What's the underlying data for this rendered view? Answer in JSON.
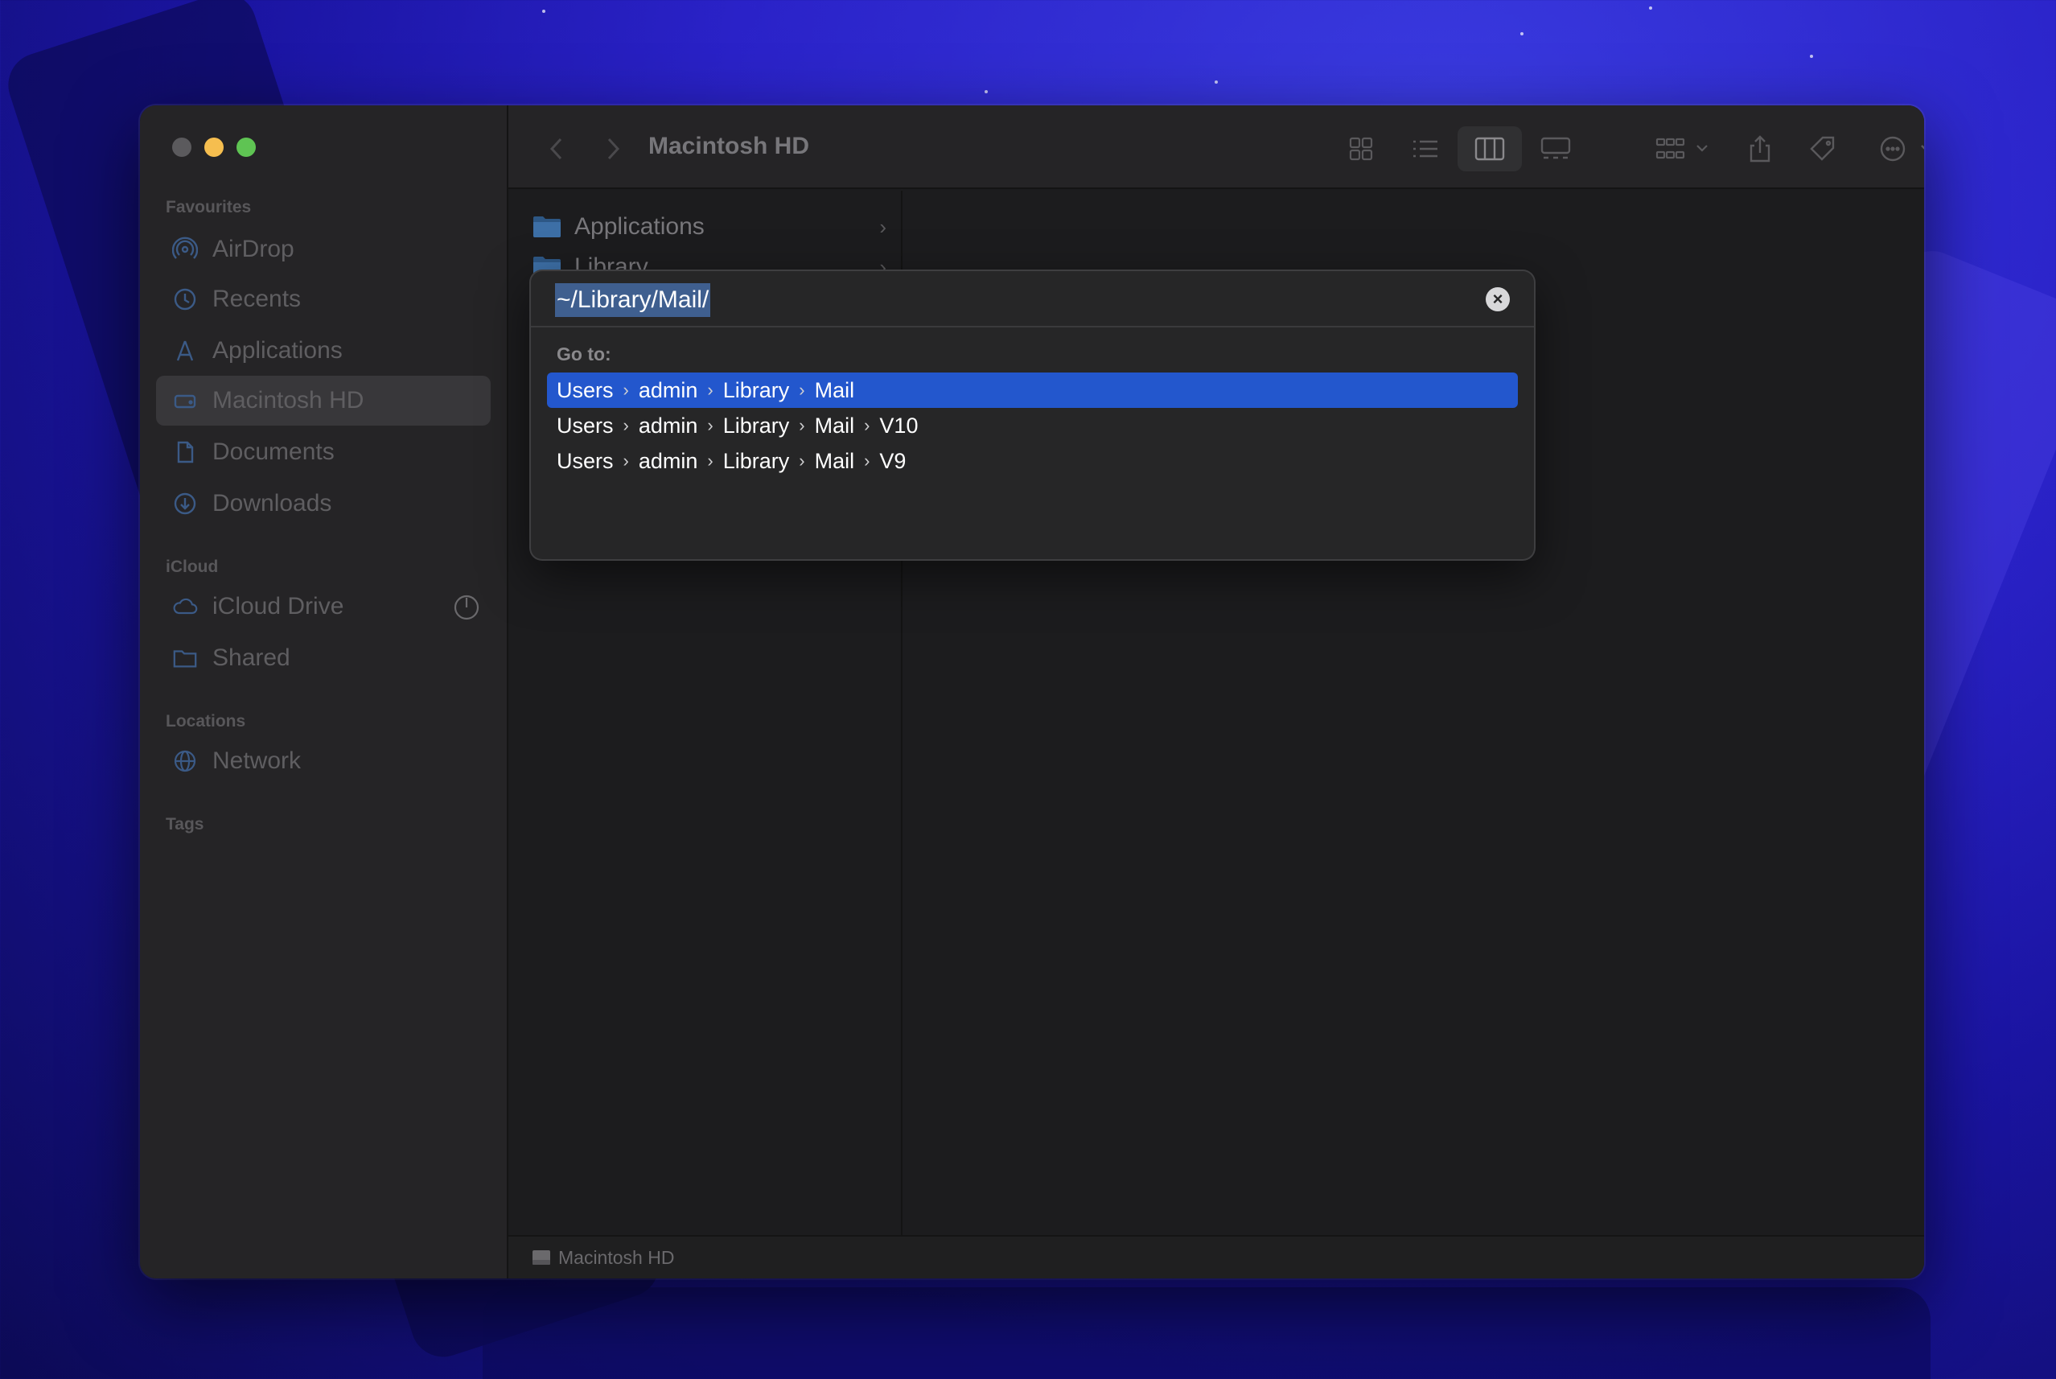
{
  "window": {
    "title": "Macintosh HD",
    "traffic_colors": [
      "#5b5a5d",
      "#f6be4f",
      "#5fc453"
    ]
  },
  "sidebar": {
    "favourites_title": "Favourites",
    "favourites": [
      {
        "label": "AirDrop",
        "icon": "airdrop-icon"
      },
      {
        "label": "Recents",
        "icon": "clock-icon"
      },
      {
        "label": "Applications",
        "icon": "applications-icon"
      },
      {
        "label": "Macintosh HD",
        "icon": "disk-icon",
        "selected": true
      },
      {
        "label": "Documents",
        "icon": "document-icon"
      },
      {
        "label": "Downloads",
        "icon": "download-icon"
      }
    ],
    "icloud_title": "iCloud",
    "icloud": [
      {
        "label": "iCloud Drive",
        "icon": "cloud-icon"
      },
      {
        "label": "Shared",
        "icon": "shared-folder-icon"
      }
    ],
    "locations_title": "Locations",
    "locations": [
      {
        "label": "Network",
        "icon": "globe-icon"
      }
    ],
    "tags_title": "Tags"
  },
  "columns": {
    "files": [
      {
        "name": "Applications",
        "icon": "folder-icon"
      },
      {
        "name": "Library",
        "icon": "folder-icon"
      }
    ]
  },
  "status_bar": {
    "path_label": "Macintosh HD"
  },
  "goto_dialog": {
    "path_value": "~/Library/Mail/",
    "goto_label": "Go to:",
    "suggestions": [
      {
        "segments": [
          "Users",
          "admin",
          "Library",
          "Mail"
        ],
        "selected": true
      },
      {
        "segments": [
          "Users",
          "admin",
          "Library",
          "Mail",
          "V10"
        ],
        "selected": false
      },
      {
        "segments": [
          "Users",
          "admin",
          "Library",
          "Mail",
          "V9"
        ],
        "selected": false
      }
    ]
  },
  "colors": {
    "accent": "#2357cd",
    "sidebar_bg": "#252426",
    "folder_blue": "#3d6fa6"
  }
}
